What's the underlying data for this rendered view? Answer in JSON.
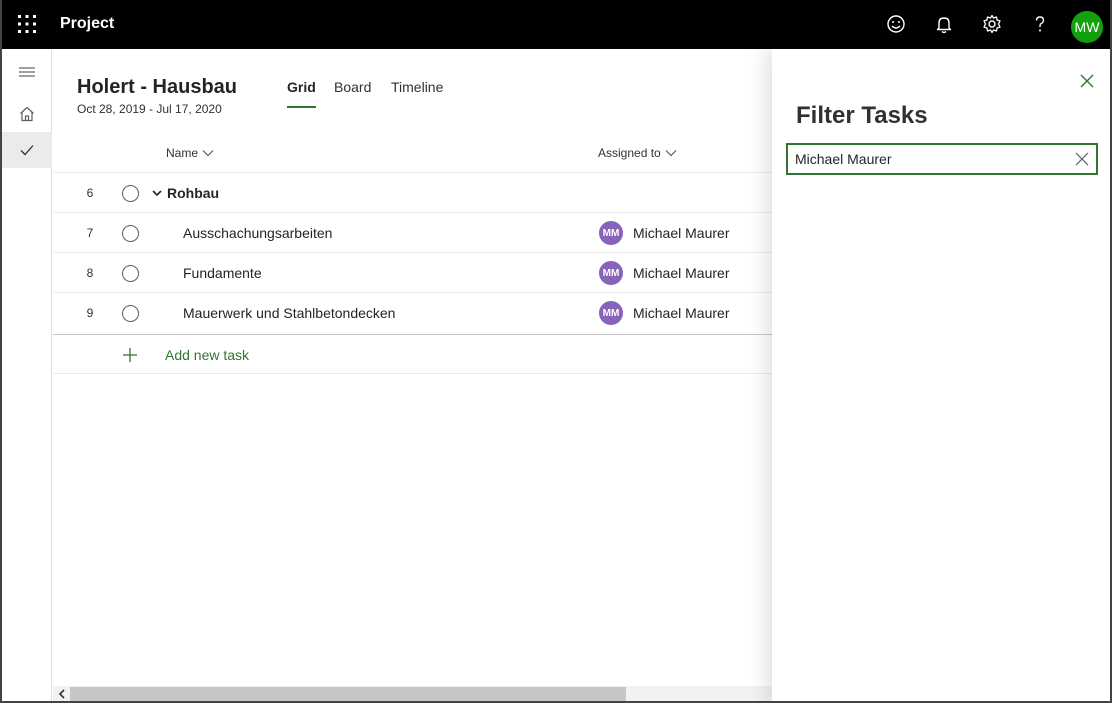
{
  "app": {
    "title": "Project",
    "user_initials": "MW",
    "user_avatar_color": "#13a10e"
  },
  "header_icons": [
    "waffle-icon",
    "smiley-icon",
    "bell-icon",
    "gear-icon",
    "help-icon"
  ],
  "plan": {
    "title": "Holert - Hausbau",
    "dates": "Oct 28, 2019 - Jul 17, 2020"
  },
  "tabs": [
    {
      "label": "Grid",
      "active": true
    },
    {
      "label": "Board",
      "active": false
    },
    {
      "label": "Timeline",
      "active": false
    }
  ],
  "columns": {
    "name": "Name",
    "assigned": "Assigned to"
  },
  "group": {
    "num": "6",
    "name": "Rohbau"
  },
  "tasks": [
    {
      "num": "7",
      "name": "Ausschachungsarbeiten",
      "initials": "MM",
      "assignee": "Michael Maurer"
    },
    {
      "num": "8",
      "name": "Fundamente",
      "initials": "MM",
      "assignee": "Michael Maurer"
    },
    {
      "num": "9",
      "name": "Mauerwerk und Stahlbetondecken",
      "initials": "MM",
      "assignee": "Michael Maurer"
    }
  ],
  "add_task": {
    "label": "Add new task"
  },
  "filter": {
    "title": "Filter Tasks",
    "value": "Michael Maurer"
  },
  "colors": {
    "accent": "#31752f",
    "avatar": "#8764b8",
    "topbar": "#000000"
  }
}
